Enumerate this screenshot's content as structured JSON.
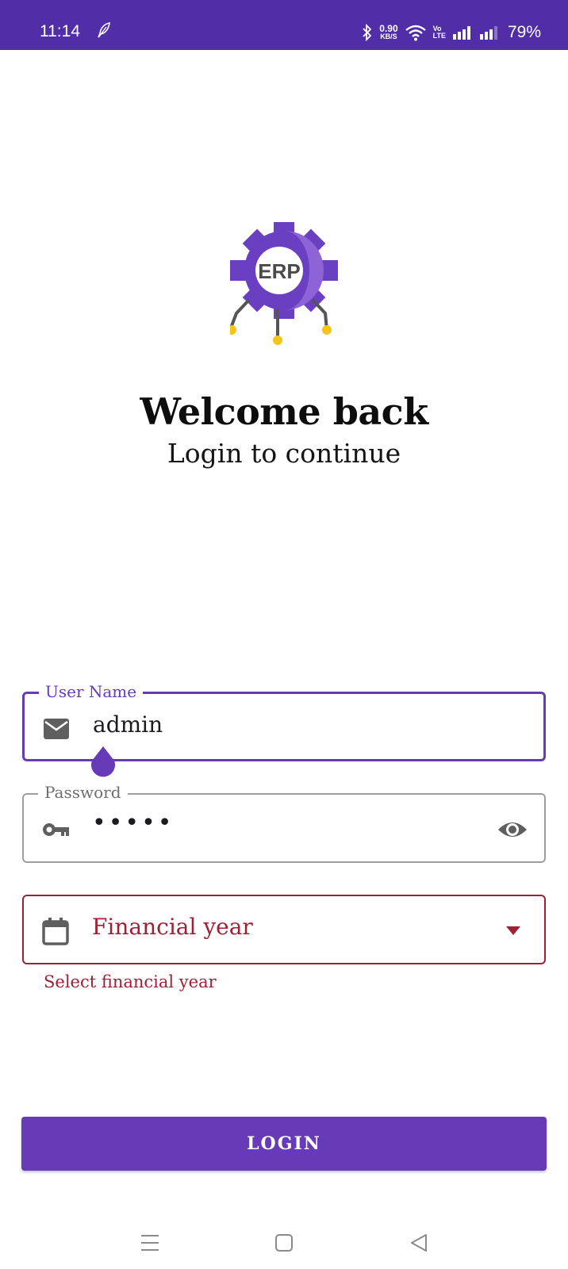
{
  "status_bar": {
    "time": "11:14",
    "net_speed_value": "0.90",
    "net_speed_unit": "KB/S",
    "volte_top": "Vo",
    "volte_bottom": "LTE",
    "battery": "79%",
    "icons": [
      "feather-icon",
      "bluetooth-icon",
      "wifi-icon",
      "signal-icon",
      "signal-icon"
    ]
  },
  "header": {
    "logo_text": "ERP",
    "title": "Welcome back",
    "subtitle": "Login to continue"
  },
  "form": {
    "username": {
      "label": "User Name",
      "value": "admin",
      "icon": "email-icon"
    },
    "password": {
      "label": "Password",
      "value": "•••••",
      "icon": "key-icon",
      "toggle_icon": "eye-icon"
    },
    "financial_year": {
      "placeholder": "Financial year",
      "icon": "calendar-icon",
      "error": "Select financial year"
    },
    "login_label": "LOGIN"
  },
  "colors": {
    "primary": "#673ab7",
    "status_bar": "#512da8",
    "error": "#9f1f35",
    "logo_accent": "#f5c518"
  },
  "nav_bar": {
    "icons": [
      "menu-icon",
      "home-icon",
      "back-icon"
    ]
  }
}
